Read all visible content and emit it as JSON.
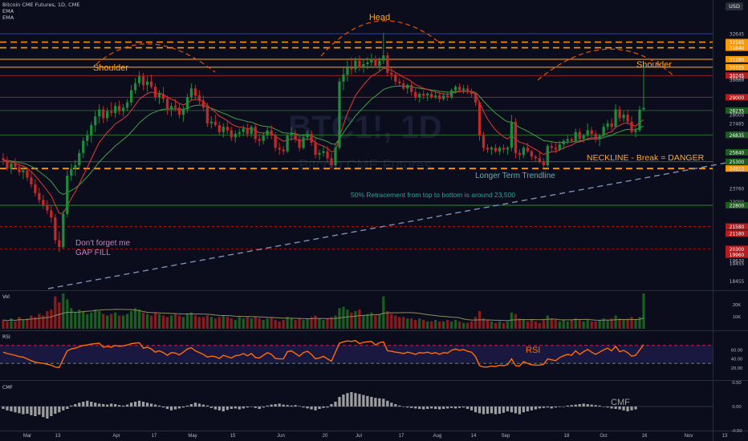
{
  "header": {
    "title": "Bitcoin CME Futures, 1D, CME",
    "ind1": "EMA",
    "ind2": "EMA",
    "currency": "USD"
  },
  "watermark": {
    "symbol": "BTC1!, 1D",
    "name": "Bitcoin CME Futures"
  },
  "panels": {
    "vol": "Vol",
    "rsi": "RSI",
    "cmf": "CMF"
  },
  "colors": {
    "bg": "#0b0d1c",
    "up": "#1e8c3a",
    "down": "#c62828",
    "ema_fast": "#e53935",
    "ema_slow": "#43a047",
    "level_orange": "#ff9800",
    "rsi_line": "#ff6d00",
    "cmf_bar": "#9e9e9e",
    "trendline": "#7e8fb5",
    "annotation_orange": "#ffa726",
    "annotation_teal": "#5fb3b3",
    "annotation_pink": "#d279c4"
  },
  "annotations": {
    "head": "Head",
    "left_shoulder": "Shoulder",
    "right_shoulder": "Shoulder",
    "neckline": "NECKLINE - Break = DANGER",
    "trendline": "Longer Term Trendline",
    "retracement": "50% Retracement from top to bottom is around 23,500",
    "gap1": "Don't forget me",
    "gap2": "GAP FILL",
    "rsi": "RSI",
    "cmf": "CMF"
  },
  "chart_data": {
    "type": "candlestick",
    "title": "Bitcoin CME Futures, 1D, CME",
    "y_axis_labels": [
      "32645",
      "32165",
      "31840",
      "31180",
      "30725",
      "30245",
      "30125",
      "30000",
      "29000",
      "28235",
      "28000",
      "27485",
      "26935",
      "26835",
      "25840",
      "25300",
      "24910",
      "24870",
      "23000",
      "23760",
      "22800",
      "21580",
      "21180",
      "20300",
      "19960",
      "19630",
      "19455",
      "18455"
    ],
    "x_axis_labels": [
      "Mar",
      "13",
      "Apr",
      "17",
      "May",
      "15",
      "Jun",
      "20",
      "Jul",
      "17",
      "Aug",
      "14",
      "Sep",
      "18",
      "Oct",
      "16",
      "Nov",
      "13"
    ],
    "candles_ohlc": [
      [
        25500,
        25800,
        25100,
        25400
      ],
      [
        25400,
        25600,
        24800,
        24900
      ],
      [
        24900,
        25300,
        24600,
        25200
      ],
      [
        25200,
        25500,
        24900,
        25000
      ],
      [
        25000,
        25200,
        24500,
        24700
      ],
      [
        24700,
        25000,
        24300,
        24800
      ],
      [
        24800,
        25000,
        24200,
        24400
      ],
      [
        24400,
        24700,
        23800,
        24000
      ],
      [
        24000,
        24300,
        23300,
        23500
      ],
      [
        23500,
        23800,
        22900,
        23100
      ],
      [
        23100,
        23400,
        22600,
        22800
      ],
      [
        22800,
        23100,
        22300,
        22500
      ],
      [
        22500,
        22800,
        21800,
        22100
      ],
      [
        22100,
        22300,
        20600,
        20800
      ],
      [
        20800,
        21300,
        20100,
        20400
      ],
      [
        20400,
        22500,
        20300,
        22300
      ],
      [
        22300,
        24800,
        22100,
        24500
      ],
      [
        24500,
        25200,
        24200,
        24900
      ],
      [
        24900,
        25400,
        24500,
        25100
      ],
      [
        25100,
        26000,
        24900,
        25800
      ],
      [
        25800,
        26700,
        25500,
        26500
      ],
      [
        26500,
        27100,
        26200,
        26800
      ],
      [
        26800,
        27600,
        26400,
        27400
      ],
      [
        27400,
        28200,
        27000,
        27900
      ],
      [
        27900,
        28600,
        27500,
        28300
      ],
      [
        28300,
        28500,
        27500,
        27800
      ],
      [
        27800,
        28400,
        27600,
        28200
      ],
      [
        28200,
        28700,
        27900,
        28100
      ],
      [
        28100,
        28700,
        27800,
        28500
      ],
      [
        28500,
        28800,
        28000,
        28200
      ],
      [
        28200,
        28600,
        27900,
        28400
      ],
      [
        28400,
        28900,
        28200,
        28700
      ],
      [
        28700,
        29700,
        28500,
        29400
      ],
      [
        29400,
        30100,
        29200,
        29800
      ],
      [
        29800,
        30500,
        29600,
        30200
      ],
      [
        30200,
        30400,
        29400,
        29700
      ],
      [
        29700,
        30200,
        29300,
        29900
      ],
      [
        29900,
        30300,
        29500,
        29600
      ],
      [
        29600,
        29800,
        28800,
        29000
      ],
      [
        29000,
        29400,
        28600,
        29200
      ],
      [
        29200,
        29600,
        28700,
        28900
      ],
      [
        28900,
        29100,
        28000,
        28300
      ],
      [
        28300,
        28700,
        27900,
        28500
      ],
      [
        28500,
        28900,
        28200,
        28400
      ],
      [
        28400,
        28600,
        27800,
        28000
      ],
      [
        28000,
        28500,
        27600,
        28300
      ],
      [
        28300,
        29200,
        28100,
        29000
      ],
      [
        29000,
        29800,
        28800,
        29500
      ],
      [
        29500,
        29700,
        28900,
        29100
      ],
      [
        29100,
        29400,
        28600,
        28800
      ],
      [
        28800,
        29100,
        28200,
        28400
      ],
      [
        28400,
        28700,
        27300,
        27500
      ],
      [
        27500,
        27900,
        27200,
        27600
      ],
      [
        27600,
        28000,
        27300,
        27400
      ],
      [
        27400,
        27600,
        26800,
        27000
      ],
      [
        27000,
        27500,
        26700,
        27300
      ],
      [
        27300,
        27600,
        26900,
        27100
      ],
      [
        27100,
        27300,
        26500,
        26700
      ],
      [
        26700,
        27100,
        26400,
        26900
      ],
      [
        26900,
        27200,
        26700,
        27000
      ],
      [
        27000,
        27400,
        26800,
        27200
      ],
      [
        27200,
        27500,
        26700,
        26900
      ],
      [
        26900,
        27400,
        26700,
        27300
      ],
      [
        27300,
        27500,
        26400,
        26600
      ],
      [
        26600,
        26900,
        26200,
        26500
      ],
      [
        26500,
        27000,
        26300,
        26800
      ],
      [
        26800,
        27300,
        26600,
        27100
      ],
      [
        27100,
        27400,
        26600,
        26800
      ],
      [
        26800,
        27000,
        25900,
        26100
      ],
      [
        26100,
        26400,
        25700,
        26000
      ],
      [
        26000,
        26200,
        25700,
        25900
      ],
      [
        25900,
        26900,
        25800,
        26800
      ],
      [
        26800,
        27300,
        26500,
        26900
      ],
      [
        26900,
        27100,
        26400,
        26600
      ],
      [
        26600,
        26800,
        25900,
        26100
      ],
      [
        26100,
        26900,
        26000,
        26700
      ],
      [
        26700,
        27100,
        26500,
        26900
      ],
      [
        26900,
        27100,
        26200,
        26400
      ],
      [
        26400,
        26700,
        25500,
        25700
      ],
      [
        25700,
        26000,
        25400,
        25800
      ],
      [
        25800,
        26200,
        25600,
        25900
      ],
      [
        25900,
        26200,
        25300,
        25500
      ],
      [
        25500,
        25800,
        24900,
        25100
      ],
      [
        25100,
        26300,
        25000,
        26100
      ],
      [
        26100,
        30100,
        26000,
        29900
      ],
      [
        29900,
        30700,
        29400,
        30300
      ],
      [
        30300,
        31100,
        29900,
        30700
      ],
      [
        30700,
        31300,
        30300,
        30600
      ],
      [
        30600,
        31300,
        30400,
        31100
      ],
      [
        31100,
        31400,
        30500,
        30700
      ],
      [
        30700,
        31200,
        30400,
        30900
      ],
      [
        30900,
        31300,
        30600,
        31000
      ],
      [
        31000,
        31500,
        30700,
        31200
      ],
      [
        31200,
        31400,
        30700,
        30800
      ],
      [
        30800,
        31300,
        30500,
        31100
      ],
      [
        31100,
        32700,
        30900,
        31400
      ],
      [
        31400,
        31600,
        30200,
        30400
      ],
      [
        30400,
        30700,
        30000,
        30300
      ],
      [
        30300,
        30400,
        29700,
        29900
      ],
      [
        29900,
        30100,
        29600,
        29800
      ],
      [
        29800,
        30000,
        29400,
        29500
      ],
      [
        29500,
        29800,
        29200,
        29700
      ],
      [
        29700,
        29900,
        29100,
        29300
      ],
      [
        29300,
        29500,
        28800,
        29000
      ],
      [
        29000,
        29300,
        28700,
        29200
      ],
      [
        29200,
        29400,
        28900,
        29100
      ],
      [
        29100,
        29300,
        28800,
        29200
      ],
      [
        29200,
        29400,
        28900,
        29000
      ],
      [
        29000,
        29300,
        28900,
        29100
      ],
      [
        29100,
        29300,
        28700,
        28900
      ],
      [
        28900,
        29200,
        28800,
        29100
      ],
      [
        29100,
        29300,
        28800,
        29000
      ],
      [
        29000,
        29500,
        28900,
        29400
      ],
      [
        29400,
        29700,
        29200,
        29600
      ],
      [
        29600,
        29800,
        29300,
        29400
      ],
      [
        29400,
        29700,
        29200,
        29500
      ],
      [
        29500,
        29700,
        29200,
        29300
      ],
      [
        29300,
        29500,
        29000,
        29200
      ],
      [
        29200,
        29300,
        28500,
        28700
      ],
      [
        28700,
        28800,
        26500,
        26800
      ],
      [
        26800,
        27000,
        25900,
        26100
      ],
      [
        26100,
        26300,
        25800,
        26000
      ],
      [
        26000,
        26200,
        25700,
        26100
      ],
      [
        26100,
        26300,
        25800,
        25900
      ],
      [
        25900,
        26200,
        25700,
        26100
      ],
      [
        26100,
        26300,
        25800,
        26000
      ],
      [
        26000,
        26200,
        25700,
        26100
      ],
      [
        26100,
        28000,
        25900,
        27600
      ],
      [
        27600,
        27800,
        25500,
        25800
      ],
      [
        25800,
        26000,
        25400,
        25700
      ],
      [
        25700,
        26200,
        25500,
        26100
      ],
      [
        26100,
        26400,
        25800,
        25900
      ],
      [
        25900,
        26000,
        25400,
        25600
      ],
      [
        25600,
        25700,
        25300,
        25500
      ],
      [
        25500,
        25900,
        25200,
        25300
      ],
      [
        25300,
        25500,
        24900,
        25100
      ],
      [
        25100,
        26300,
        25000,
        26200
      ],
      [
        26200,
        26500,
        25900,
        26100
      ],
      [
        26100,
        26400,
        25800,
        26000
      ],
      [
        26000,
        26500,
        25900,
        26300
      ],
      [
        26300,
        26600,
        26000,
        26500
      ],
      [
        26500,
        26800,
        26300,
        26600
      ],
      [
        26600,
        26700,
        26400,
        26500
      ],
      [
        26500,
        27200,
        26400,
        27000
      ],
      [
        27000,
        27200,
        26500,
        26600
      ],
      [
        26600,
        26900,
        26400,
        26800
      ],
      [
        26800,
        27500,
        26700,
        27100
      ],
      [
        27100,
        27300,
        26700,
        26900
      ],
      [
        26900,
        27100,
        26400,
        26600
      ],
      [
        26600,
        26900,
        26200,
        26800
      ],
      [
        26800,
        27500,
        26700,
        27300
      ],
      [
        27300,
        27700,
        27100,
        27500
      ],
      [
        27500,
        27800,
        27100,
        27300
      ],
      [
        27300,
        28600,
        27200,
        28300
      ],
      [
        28300,
        28500,
        27600,
        27800
      ],
      [
        27800,
        28200,
        27600,
        28000
      ],
      [
        28000,
        28300,
        27400,
        27600
      ],
      [
        27600,
        27900,
        26900,
        27000
      ],
      [
        27000,
        27300,
        26700,
        27100
      ],
      [
        27100,
        28500,
        27000,
        28300
      ],
      [
        28300,
        30900,
        28200,
        28400
      ]
    ],
    "volume": [
      6,
      5,
      7,
      5,
      8,
      6,
      7,
      9,
      8,
      10,
      9,
      12,
      13,
      22,
      18,
      24,
      20,
      14,
      11,
      13,
      12,
      10,
      11,
      13,
      12,
      10,
      9,
      10,
      11,
      9,
      9,
      10,
      12,
      14,
      13,
      11,
      10,
      9,
      11,
      10,
      9,
      8,
      9,
      10,
      9,
      8,
      10,
      11,
      9,
      8,
      8,
      9,
      8,
      7,
      8,
      9,
      8,
      7,
      6,
      8,
      7,
      8,
      7,
      8,
      7,
      6,
      7,
      8,
      6,
      5,
      6,
      8,
      7,
      6,
      7,
      6,
      7,
      8,
      9,
      7,
      6,
      7,
      8,
      9,
      14,
      15,
      13,
      11,
      12,
      13,
      9,
      10,
      11,
      9,
      10,
      22,
      12,
      10,
      9,
      8,
      8,
      7,
      7,
      6,
      7,
      6,
      5,
      5,
      6,
      5,
      5,
      6,
      5,
      6,
      5,
      4,
      4,
      5,
      8,
      12,
      7,
      6,
      5,
      4,
      5,
      4,
      5,
      11,
      10,
      7,
      6,
      5,
      6,
      5,
      4,
      6,
      9,
      7,
      6,
      5,
      6,
      5,
      6,
      7,
      6,
      5,
      6,
      5,
      5,
      6,
      7,
      6,
      7,
      9,
      7,
      6,
      7,
      8,
      6,
      8,
      24
    ],
    "rsi": [
      55,
      52,
      50,
      48,
      45,
      44,
      40,
      36,
      33,
      31,
      30,
      28,
      26,
      22,
      21,
      40,
      58,
      62,
      64,
      67,
      70,
      71,
      73,
      74,
      75,
      66,
      68,
      66,
      70,
      68,
      69,
      71,
      74,
      75,
      76,
      64,
      66,
      62,
      55,
      58,
      54,
      48,
      54,
      53,
      49,
      55,
      62,
      65,
      58,
      54,
      50,
      44,
      46,
      45,
      41,
      48,
      45,
      42,
      47,
      48,
      52,
      47,
      52,
      43,
      42,
      48,
      54,
      50,
      41,
      40,
      40,
      56,
      58,
      52,
      46,
      54,
      57,
      50,
      40,
      42,
      46,
      40,
      35,
      55,
      75,
      78,
      80,
      79,
      81,
      74,
      77,
      78,
      79,
      71,
      76,
      78,
      58,
      57,
      55,
      54,
      52,
      55,
      53,
      50,
      54,
      53,
      55,
      52,
      54,
      50,
      54,
      53,
      59,
      62,
      59,
      61,
      57,
      55,
      45,
      25,
      22,
      22,
      24,
      23,
      26,
      25,
      27,
      40,
      25,
      24,
      34,
      30,
      27,
      26,
      26,
      28,
      40,
      38,
      36,
      43,
      47,
      50,
      48,
      58,
      50,
      56,
      61,
      55,
      50,
      55,
      60,
      64,
      58,
      68,
      56,
      59,
      54,
      46,
      48,
      60,
      72
    ],
    "cmf": [
      -0.05,
      -0.08,
      -0.1,
      -0.12,
      -0.14,
      -0.16,
      -0.15,
      -0.18,
      -0.2,
      -0.17,
      -0.22,
      -0.25,
      -0.2,
      -0.15,
      -0.12,
      -0.08,
      -0.05,
      0.02,
      0.05,
      0.08,
      0.1,
      0.12,
      0.1,
      0.08,
      0.06,
      0.05,
      0.04,
      0.06,
      0.05,
      0.03,
      0.02,
      0.04,
      0.08,
      0.1,
      0.12,
      0.1,
      0.08,
      0.06,
      0.04,
      0.02,
      -0.02,
      -0.05,
      -0.08,
      -0.06,
      -0.04,
      -0.02,
      0.02,
      0.05,
      0.08,
      0.06,
      0.04,
      0.02,
      -0.03,
      -0.06,
      -0.08,
      -0.1,
      -0.07,
      -0.05,
      -0.04,
      -0.06,
      -0.04,
      -0.02,
      0.0,
      -0.03,
      -0.05,
      -0.02,
      0.02,
      0.04,
      0.05,
      0.06,
      0.04,
      0.03,
      0.02,
      0.03,
      0.01,
      -0.02,
      -0.04,
      -0.06,
      -0.08,
      -0.05,
      -0.03,
      -0.02,
      0.05,
      0.1,
      0.2,
      0.25,
      0.28,
      0.3,
      0.28,
      0.26,
      0.24,
      0.22,
      0.2,
      0.18,
      0.17,
      0.16,
      0.12,
      0.08,
      0.05,
      0.02,
      0.0,
      -0.02,
      -0.03,
      -0.04,
      -0.05,
      -0.06,
      -0.05,
      -0.04,
      -0.05,
      -0.06,
      -0.05,
      -0.04,
      -0.03,
      -0.04,
      -0.03,
      -0.02,
      -0.05,
      -0.08,
      -0.12,
      -0.14,
      -0.16,
      -0.15,
      -0.14,
      -0.16,
      -0.15,
      -0.13,
      -0.1,
      -0.12,
      -0.14,
      -0.16,
      -0.12,
      -0.1,
      -0.08,
      -0.06,
      -0.04,
      -0.03,
      -0.02,
      -0.04,
      -0.02,
      -0.01,
      0.0,
      0.02,
      0.03,
      0.04,
      0.05,
      0.06,
      0.05,
      0.04,
      0.03,
      0.02,
      0.0,
      -0.02,
      -0.04,
      -0.05,
      -0.06,
      -0.08,
      -0.1,
      -0.08,
      -0.06
    ]
  }
}
